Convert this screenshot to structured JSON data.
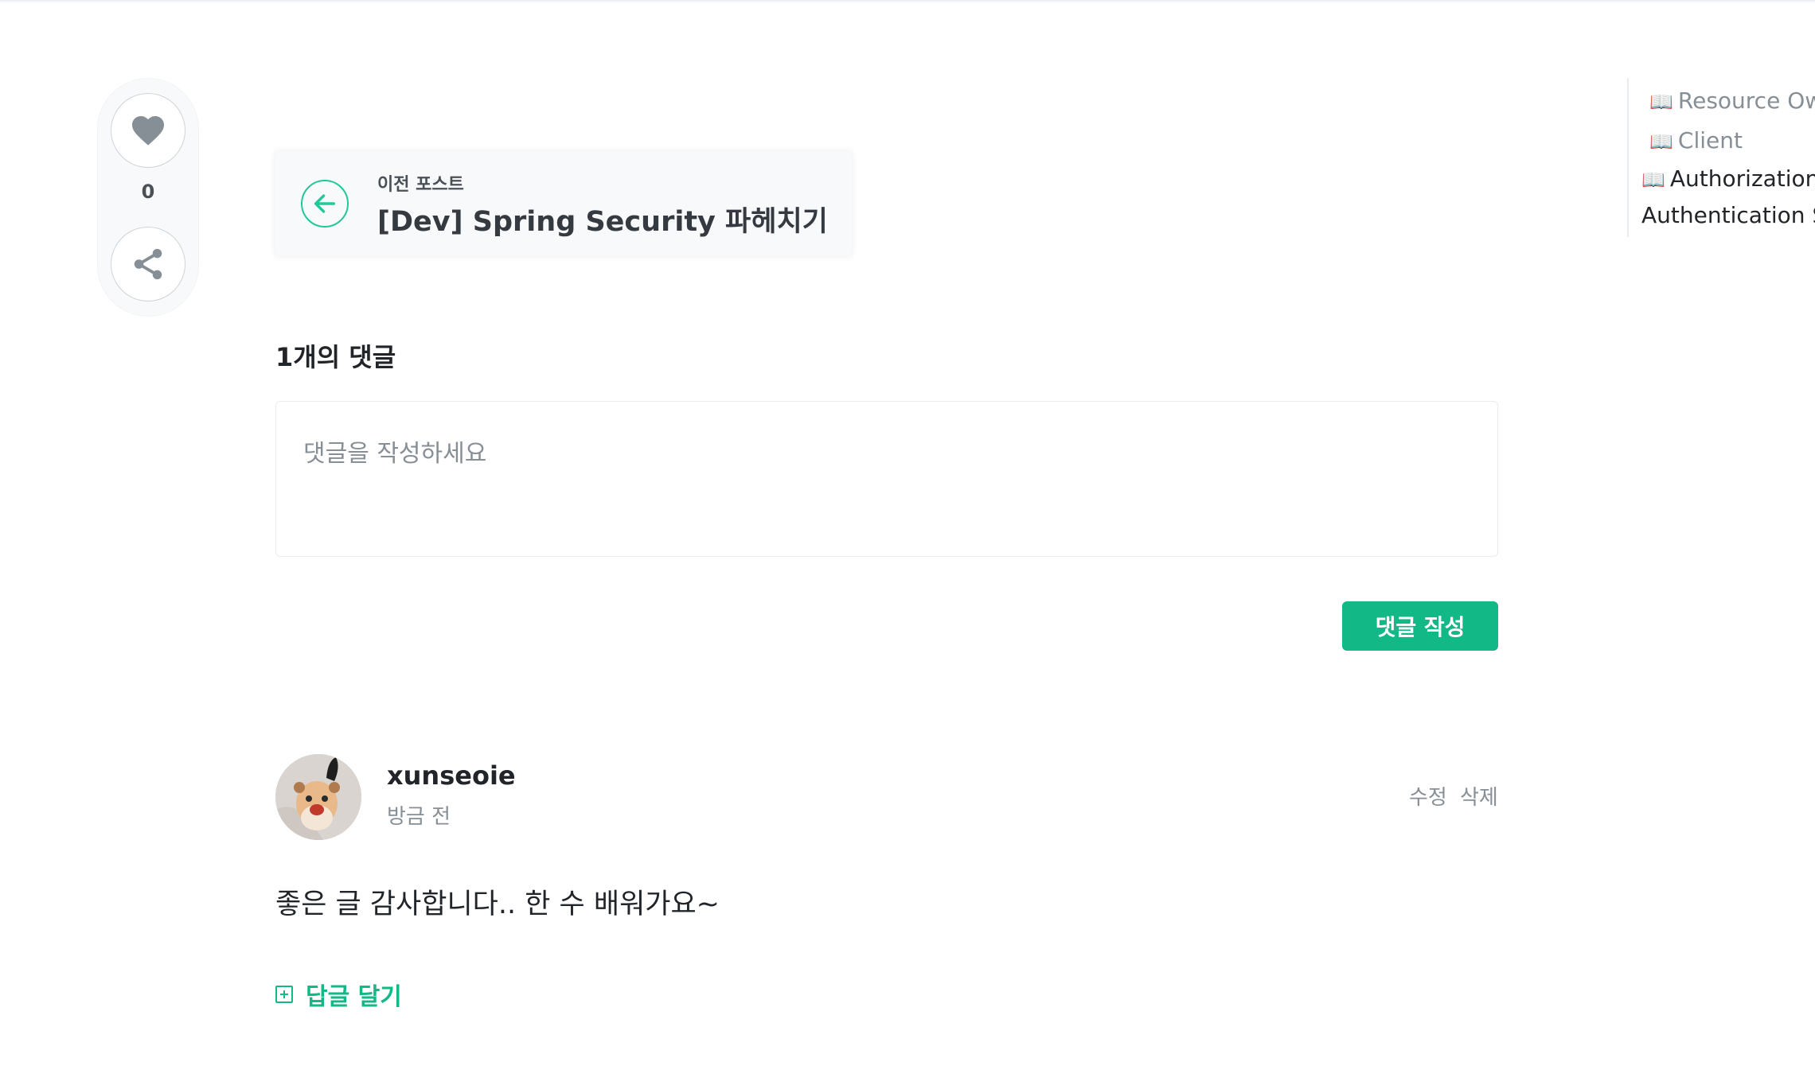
{
  "sidebar": {
    "like_icon": "heart-icon",
    "like_count": "0",
    "share_icon": "share-icon"
  },
  "prev_post": {
    "label": "이전 포스트",
    "title": "[Dev] Spring Security 파헤치기",
    "icon": "arrow-left-icon"
  },
  "comments": {
    "count_label": "1개의 댓글",
    "placeholder": "댓글을 작성하세요",
    "submit_label": "댓글 작성",
    "items": [
      {
        "author": "xunseoie",
        "time": "방금 전",
        "edit_label": "수정",
        "delete_label": "삭제",
        "text": "좋은 글 감사합니다.. 한 수 배워가요~",
        "reply_label": "답글 달기"
      }
    ]
  },
  "toc": {
    "items": [
      {
        "icon": "📖",
        "label": "Resource Owner"
      },
      {
        "icon": "📖",
        "label": "Client"
      },
      {
        "icon": "📖",
        "label": "Authorization Server"
      },
      {
        "icon": "",
        "label": "Authentication Server"
      }
    ]
  },
  "colors": {
    "accent": "#12b886",
    "accent_light": "#20c997",
    "muted_text": "#868e96",
    "card_bg": "#f8f9fa"
  }
}
